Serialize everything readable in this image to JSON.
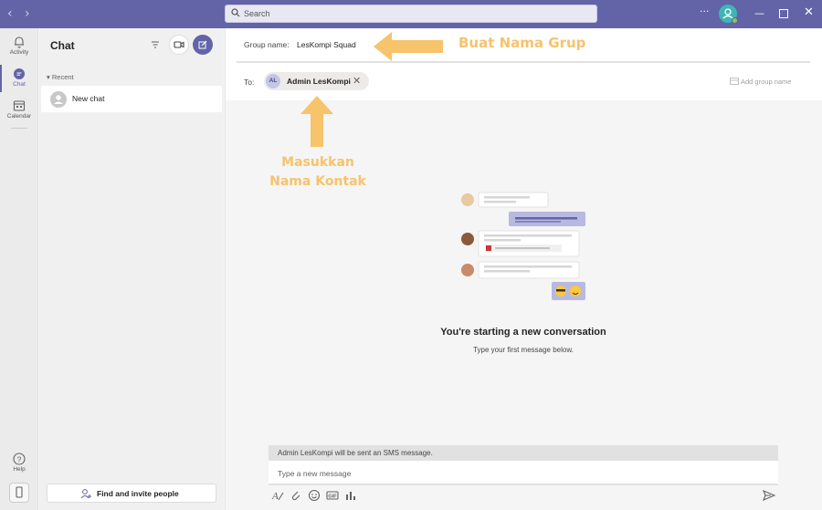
{
  "titlebar": {
    "search_placeholder": "Search",
    "more": "···",
    "accent": "#6264a7"
  },
  "rail": {
    "items": [
      {
        "label": "Activity",
        "icon": "bell-icon"
      },
      {
        "label": "Chat",
        "icon": "chat-icon",
        "active": true
      },
      {
        "label": "Calendar",
        "icon": "calendar-icon"
      }
    ],
    "help_label": "Help"
  },
  "chatlist": {
    "title": "Chat",
    "section": "Recent",
    "new_chat": "New chat",
    "invite_label": "Find and invite people"
  },
  "header": {
    "group_name_label": "Group name:",
    "group_name_value": "LesKompi Squad",
    "to_label": "To:",
    "recipient": {
      "initials": "AL",
      "name": "Admin LesKompi"
    },
    "add_group_name": "Add group name"
  },
  "annotations": {
    "group": "Buat Nama Grup",
    "contact_line1": "Masukkan",
    "contact_line2": "Nama Kontak",
    "color": "#f7c36b"
  },
  "empty_state": {
    "title": "You're starting a new conversation",
    "subtitle": "Type your first message below."
  },
  "compose": {
    "sms_note": "Admin LesKompi will be sent an SMS message.",
    "placeholder": "Type a new message",
    "tools": [
      "format-icon",
      "attach-icon",
      "emoji-icon",
      "gif-icon",
      "poll-icon"
    ],
    "send_icon": "send-icon"
  }
}
